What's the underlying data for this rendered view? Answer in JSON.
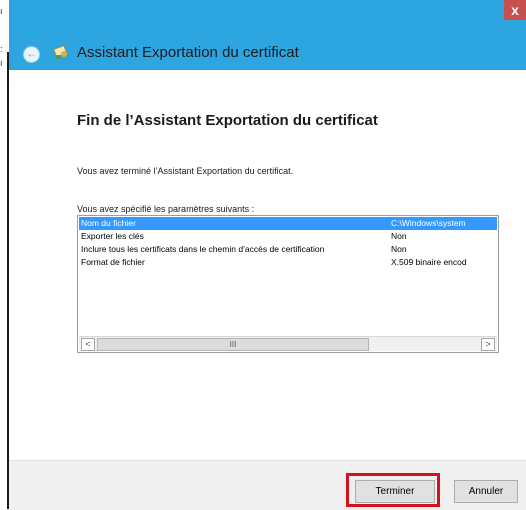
{
  "window": {
    "title": "Assistant Exportation du certificat",
    "close_label": "x",
    "back_label": "←"
  },
  "content": {
    "heading": "Fin de l’Assistant Exportation du certificat",
    "info_text": "Vous avez terminé l’Assistant Exportation du certificat.",
    "params_label": "Vous avez spécifié les paramètres suivants :",
    "rows": [
      {
        "name": "Nom du fichier",
        "value": "C:\\Windows\\system"
      },
      {
        "name": "Exporter les clés",
        "value": "Non"
      },
      {
        "name": "Inclure tous les certificats dans le chemin d’accès de certification",
        "value": "Non"
      },
      {
        "name": "Format de fichier",
        "value": "X.509 binaire encod"
      }
    ],
    "scroll_left": "<",
    "scroll_thumb": "III",
    "scroll_right": ">"
  },
  "footer": {
    "finish_label": "Terminer",
    "cancel_label": "Annuler"
  },
  "colors": {
    "titlebar": "#2da5e0",
    "selection": "#3399ff",
    "highlight": "#d4121e"
  }
}
